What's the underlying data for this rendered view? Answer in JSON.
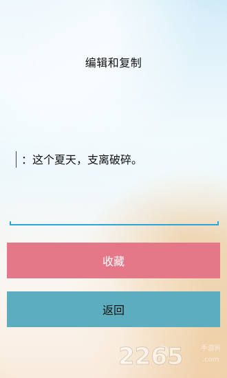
{
  "title": "编辑和复制",
  "editor": {
    "text": "：这个夏天，支离破碎。"
  },
  "buttons": {
    "collect": "收藏",
    "back": "返回"
  },
  "watermark": {
    "logo_digits": "2265",
    "logo_suffix": ".com",
    "tag": "手游网"
  }
}
